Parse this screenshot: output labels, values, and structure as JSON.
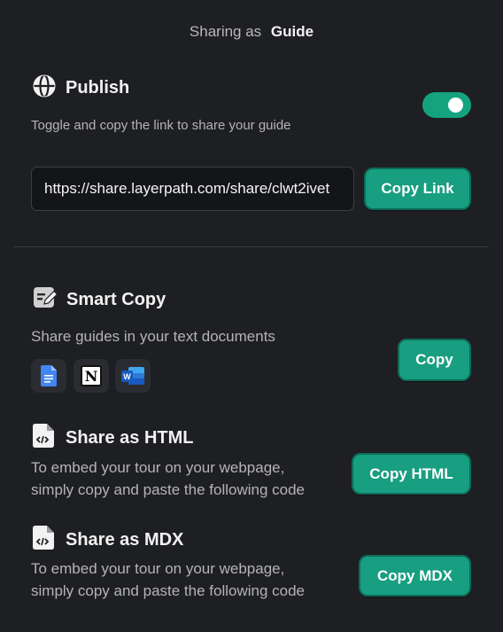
{
  "header": {
    "prefix": "Sharing as",
    "name": "Guide"
  },
  "publish": {
    "title": "Publish",
    "description": "Toggle and copy the link to share your guide",
    "toggle_on": true,
    "link": "https://share.layerpath.com/share/clwt2ivet",
    "copy_link_label": "Copy Link"
  },
  "smart_copy": {
    "title": "Smart Copy",
    "description": "Share guides in your text documents",
    "apps": [
      "google-docs-icon",
      "notion-icon",
      "word-icon"
    ],
    "notion_letter": "N",
    "word_letter": "W",
    "copy_label": "Copy"
  },
  "html": {
    "title": "Share as HTML",
    "line1": "To embed your tour on your webpage,",
    "line2": "simply copy and paste the following code",
    "copy_label": "Copy HTML"
  },
  "mdx": {
    "title": "Share as MDX",
    "line1": "To embed your tour on your webpage,",
    "line2": "simply copy and paste the following code",
    "copy_label": "Copy MDX"
  },
  "colors": {
    "accent": "#189e81",
    "background": "#1e1f22"
  }
}
